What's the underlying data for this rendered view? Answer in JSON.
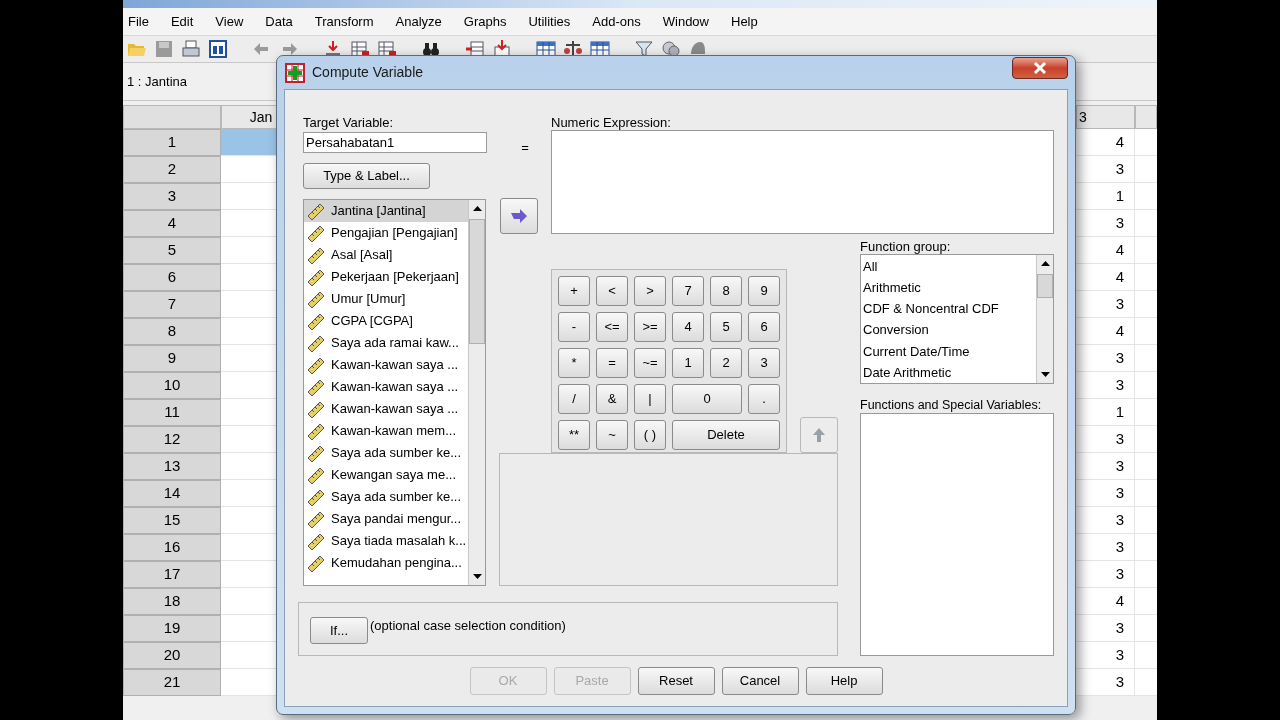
{
  "app_menu": [
    "File",
    "Edit",
    "View",
    "Data",
    "Transform",
    "Analyze",
    "Graphs",
    "Utilities",
    "Add-ons",
    "Window",
    "Help"
  ],
  "cell_reference": "1 : Jantina",
  "data_grid": {
    "columns": [
      "Jan",
      "3"
    ],
    "rows": [
      {
        "number": "1",
        "selected": true,
        "value": "4"
      },
      {
        "number": "2",
        "selected": false,
        "value": "3"
      },
      {
        "number": "3",
        "selected": false,
        "value": "1"
      },
      {
        "number": "4",
        "selected": false,
        "value": "3"
      },
      {
        "number": "5",
        "selected": false,
        "value": "4"
      },
      {
        "number": "6",
        "selected": false,
        "value": "4"
      },
      {
        "number": "7",
        "selected": false,
        "value": "3"
      },
      {
        "number": "8",
        "selected": false,
        "value": "4"
      },
      {
        "number": "9",
        "selected": false,
        "value": "3"
      },
      {
        "number": "10",
        "selected": false,
        "value": "3"
      },
      {
        "number": "11",
        "selected": false,
        "value": "1"
      },
      {
        "number": "12",
        "selected": false,
        "value": "3"
      },
      {
        "number": "13",
        "selected": false,
        "value": "3"
      },
      {
        "number": "14",
        "selected": false,
        "value": "3"
      },
      {
        "number": "15",
        "selected": false,
        "value": "3"
      },
      {
        "number": "16",
        "selected": false,
        "value": "3"
      },
      {
        "number": "17",
        "selected": false,
        "value": "3"
      },
      {
        "number": "18",
        "selected": false,
        "value": "4"
      },
      {
        "number": "19",
        "selected": false,
        "value": "3"
      },
      {
        "number": "20",
        "selected": false,
        "value": "3"
      },
      {
        "number": "21",
        "selected": false,
        "value": "3"
      }
    ]
  },
  "dialog": {
    "title": "Compute Variable",
    "target_label": "Target Variable:",
    "target_value": "Persahabatan1",
    "equals": "=",
    "type_label_button": "Type & Label...",
    "variables": [
      {
        "label": "Jantina [Jantina]",
        "selected": true
      },
      {
        "label": "Pengajian [Pengajian]",
        "selected": false
      },
      {
        "label": "Asal [Asal]",
        "selected": false
      },
      {
        "label": "Pekerjaan [Pekerjaan]",
        "selected": false
      },
      {
        "label": "Umur [Umur]",
        "selected": false
      },
      {
        "label": "CGPA [CGPA]",
        "selected": false
      },
      {
        "label": "Saya ada ramai kaw...",
        "selected": false
      },
      {
        "label": "Kawan-kawan saya ...",
        "selected": false
      },
      {
        "label": "Kawan-kawan saya ...",
        "selected": false
      },
      {
        "label": "Kawan-kawan saya ...",
        "selected": false
      },
      {
        "label": "Kawan-kawan mem...",
        "selected": false
      },
      {
        "label": "Saya ada sumber ke...",
        "selected": false
      },
      {
        "label": "Kewangan saya me...",
        "selected": false
      },
      {
        "label": "Saya ada sumber ke...",
        "selected": false
      },
      {
        "label": "Saya pandai mengur...",
        "selected": false
      },
      {
        "label": "Saya tiada masalah k...",
        "selected": false
      },
      {
        "label": "Kemudahan pengina...",
        "selected": false
      }
    ],
    "expression_label": "Numeric Expression:",
    "keypad": [
      [
        {
          "label": "+",
          "kind": "key"
        },
        {
          "label": "<",
          "kind": "key"
        },
        {
          "label": ">",
          "kind": "key"
        },
        {
          "label": "7",
          "kind": "key"
        },
        {
          "label": "8",
          "kind": "key"
        },
        {
          "label": "9",
          "kind": "key"
        }
      ],
      [
        {
          "label": "-",
          "kind": "key"
        },
        {
          "label": "<=",
          "kind": "key"
        },
        {
          "label": ">=",
          "kind": "key"
        },
        {
          "label": "4",
          "kind": "key"
        },
        {
          "label": "5",
          "kind": "key"
        },
        {
          "label": "6",
          "kind": "key"
        }
      ],
      [
        {
          "label": "*",
          "kind": "key"
        },
        {
          "label": "=",
          "kind": "key"
        },
        {
          "label": "~=",
          "kind": "key"
        },
        {
          "label": "1",
          "kind": "key"
        },
        {
          "label": "2",
          "kind": "key"
        },
        {
          "label": "3",
          "kind": "key"
        }
      ],
      [
        {
          "label": "/",
          "kind": "key"
        },
        {
          "label": "&",
          "kind": "key"
        },
        {
          "label": "|",
          "kind": "key"
        },
        {
          "label": "0",
          "kind": "wide"
        },
        {
          "label": ".",
          "kind": "key"
        }
      ],
      [
        {
          "label": "**",
          "kind": "key"
        },
        {
          "label": "~",
          "kind": "key"
        },
        {
          "label": "( )",
          "kind": "key"
        },
        {
          "label": "Delete",
          "kind": "triple"
        }
      ]
    ],
    "function_group_label": "Function group:",
    "function_groups": [
      "All",
      "Arithmetic",
      "CDF & Noncentral CDF",
      "Conversion",
      "Current Date/Time",
      "Date Arithmetic"
    ],
    "functions_label": "Functions and Special Variables:",
    "if_button": "If...",
    "if_note": "(optional case selection condition)",
    "buttons": [
      {
        "label": "OK",
        "disabled": true
      },
      {
        "label": "Paste",
        "disabled": true
      },
      {
        "label": "Reset",
        "disabled": false
      },
      {
        "label": "Cancel",
        "disabled": false
      },
      {
        "label": "Help",
        "disabled": false
      }
    ]
  }
}
